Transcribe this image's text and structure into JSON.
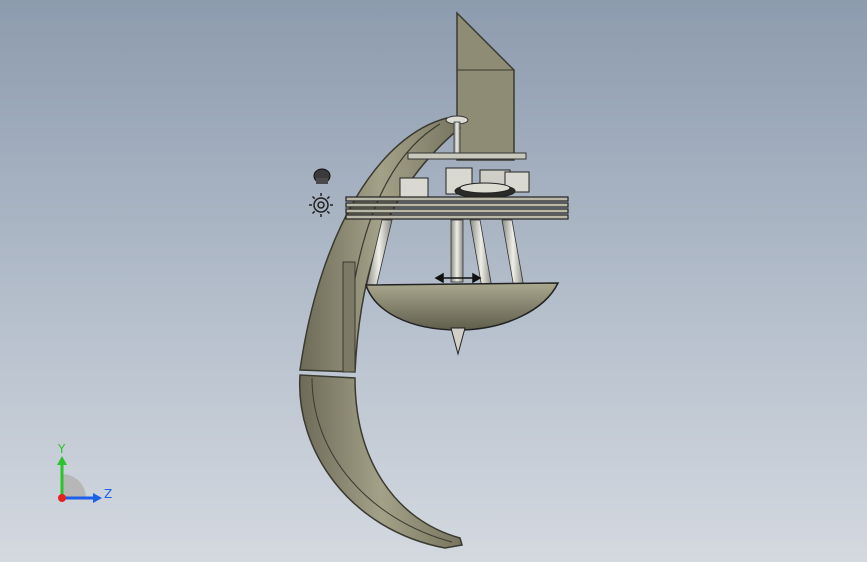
{
  "viewport": {
    "background_top": "#8d9bae",
    "background_bottom": "#d4d9e0"
  },
  "triad": {
    "y_label": "Y",
    "z_label": "Z",
    "y_color": "#2bc42b",
    "z_color": "#1c5fe8",
    "x_color": "#e52020"
  },
  "icons": {
    "light_source": "light-bulb-icon",
    "sun": "gear-sun-icon"
  },
  "model": {
    "body_color": "#8e8c74",
    "body_dark": "#5f5e4c",
    "metal_color": "#c8c8c0"
  }
}
